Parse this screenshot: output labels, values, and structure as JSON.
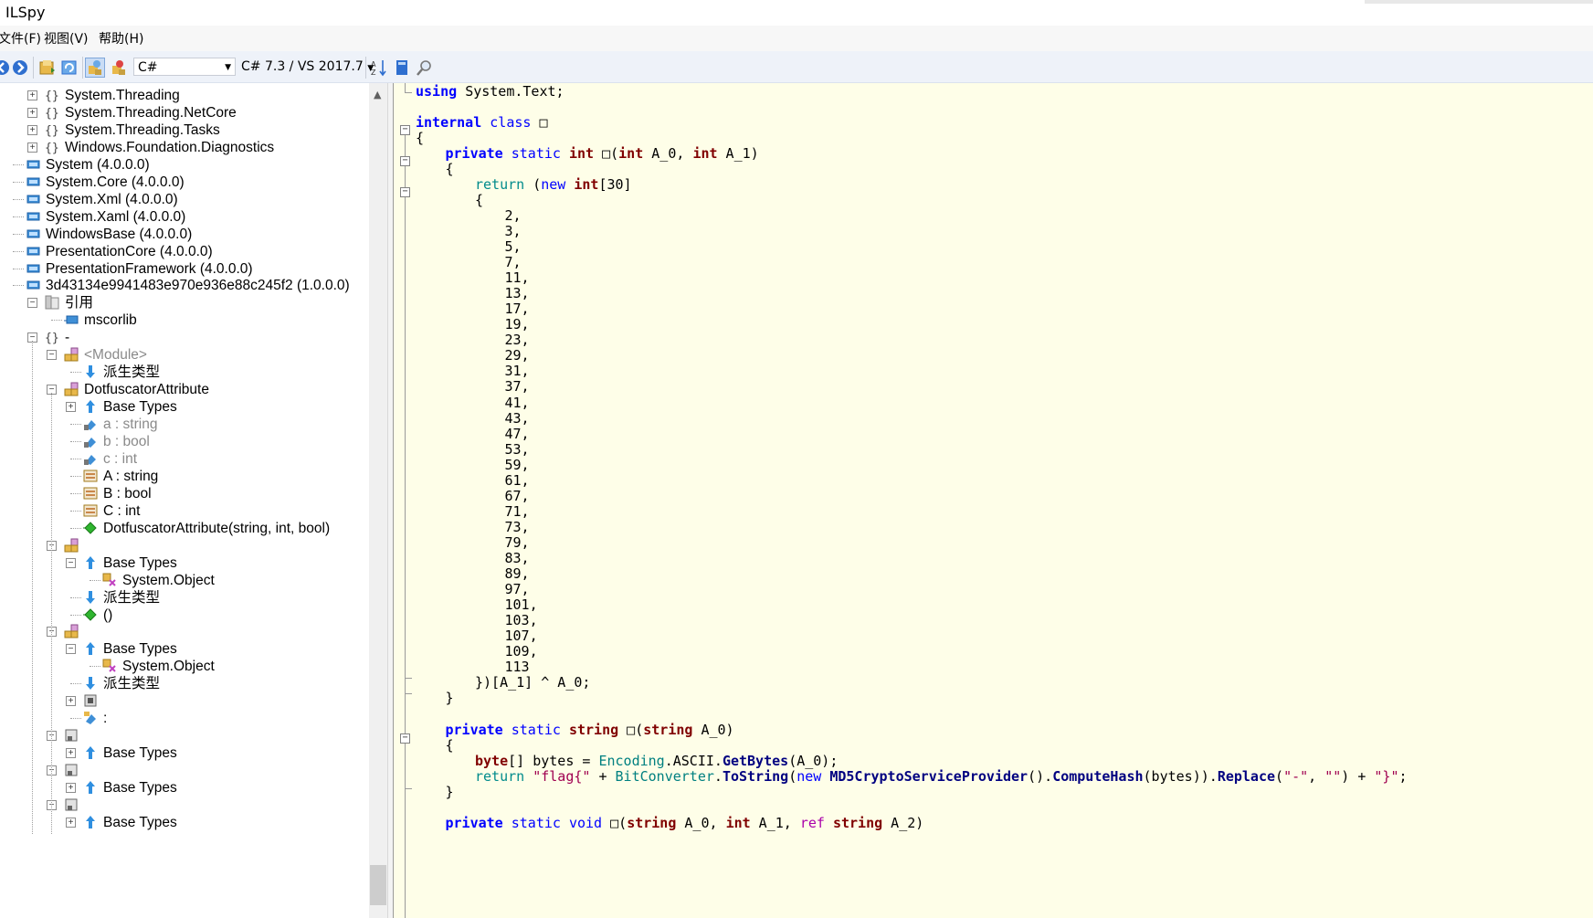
{
  "window": {
    "title": "ILSpy"
  },
  "menu": [
    "文件(F)",
    "视图(V)",
    "帮助(H)"
  ],
  "toolbar": {
    "language": "C#",
    "version": "C# 7.3 / VS 2017.7"
  },
  "tree": [
    {
      "label": "System.Threading",
      "icon": "namespace-icon",
      "toggle": "+"
    },
    {
      "label": "System.Threading.NetCore",
      "icon": "namespace-icon",
      "toggle": "+"
    },
    {
      "label": "System.Threading.Tasks",
      "icon": "namespace-icon",
      "toggle": "+"
    },
    {
      "label": "Windows.Foundation.Diagnostics",
      "icon": "namespace-icon",
      "toggle": "+"
    },
    {
      "label": "System (4.0.0.0)",
      "icon": "assembly-icon",
      "toggle": ""
    },
    {
      "label": "System.Core (4.0.0.0)",
      "icon": "assembly-icon",
      "toggle": ""
    },
    {
      "label": "System.Xml (4.0.0.0)",
      "icon": "assembly-icon",
      "toggle": ""
    },
    {
      "label": "System.Xaml (4.0.0.0)",
      "icon": "assembly-icon",
      "toggle": ""
    },
    {
      "label": "WindowsBase (4.0.0.0)",
      "icon": "assembly-icon",
      "toggle": ""
    },
    {
      "label": "PresentationCore (4.0.0.0)",
      "icon": "assembly-icon",
      "toggle": ""
    },
    {
      "label": "PresentationFramework (4.0.0.0)",
      "icon": "assembly-icon",
      "toggle": ""
    },
    {
      "label": "3d43134e9941483e970e936e88c245f2 (1.0.0.0)",
      "icon": "assembly-icon",
      "toggle": ""
    },
    {
      "label": "引用",
      "icon": "references-icon",
      "toggle": "−"
    },
    {
      "label": "mscorlib",
      "icon": "assembly-ref-icon",
      "toggle": ""
    },
    {
      "label": "-",
      "icon": "namespace-icon",
      "toggle": "−"
    },
    {
      "label": "<Module>",
      "icon": "class-icon",
      "toggle": "−",
      "dim": true
    },
    {
      "label": "派生类型",
      "icon": "derived-types-icon",
      "toggle": ""
    },
    {
      "label": "DotfuscatorAttribute",
      "icon": "class-icon",
      "toggle": "−"
    },
    {
      "label": "Base Types",
      "icon": "base-types-icon",
      "toggle": "+"
    },
    {
      "label": "a : string",
      "icon": "field-private-icon",
      "toggle": "",
      "dim": true
    },
    {
      "label": "b : bool",
      "icon": "field-private-icon",
      "toggle": "",
      "dim": true
    },
    {
      "label": "c : int",
      "icon": "field-private-icon",
      "toggle": "",
      "dim": true
    },
    {
      "label": "A : string",
      "icon": "property-icon",
      "toggle": ""
    },
    {
      "label": "B : bool",
      "icon": "property-icon",
      "toggle": ""
    },
    {
      "label": "C : int",
      "icon": "property-icon",
      "toggle": ""
    },
    {
      "label": "DotfuscatorAttribute(string, int, bool)",
      "icon": "method-icon",
      "toggle": ""
    },
    {
      "label": "",
      "icon": "class-icon",
      "toggle": "−"
    },
    {
      "label": "Base Types",
      "icon": "base-types-icon",
      "toggle": "−"
    },
    {
      "label": "System.Object",
      "icon": "class-ref-icon",
      "toggle": ""
    },
    {
      "label": "派生类型",
      "icon": "derived-types-icon",
      "toggle": ""
    },
    {
      "label": "()",
      "icon": "method-icon",
      "toggle": ""
    },
    {
      "label": "",
      "icon": "class-icon",
      "toggle": "−"
    },
    {
      "label": "Base Types",
      "icon": "base-types-icon",
      "toggle": "−"
    },
    {
      "label": "System.Object",
      "icon": "class-ref-icon",
      "toggle": ""
    },
    {
      "label": "派生类型",
      "icon": "derived-types-icon",
      "toggle": ""
    },
    {
      "label": "",
      "icon": "nested-class-icon",
      "toggle": "+"
    },
    {
      "label": ":",
      "icon": "field-icon",
      "toggle": ""
    },
    {
      "label": "",
      "icon": "struct-icon",
      "toggle": "−"
    },
    {
      "label": "Base Types",
      "icon": "base-types-icon",
      "toggle": "+"
    },
    {
      "label": "",
      "icon": "struct-icon",
      "toggle": "−"
    },
    {
      "label": "Base Types",
      "icon": "base-types-icon",
      "toggle": "+"
    },
    {
      "label": "",
      "icon": "struct-icon",
      "toggle": "−"
    },
    {
      "label": "Base Types",
      "icon": "base-types-icon",
      "toggle": "+"
    }
  ],
  "code": {
    "using": "using System.Text;",
    "primes": [
      "2,",
      "3,",
      "5,",
      "7,",
      "11,",
      "13,",
      "17,",
      "19,",
      "23,",
      "29,",
      "31,",
      "37,",
      "41,",
      "43,",
      "47,",
      "53,",
      "59,",
      "61,",
      "67,",
      "71,",
      "73,",
      "79,",
      "83,",
      "89,",
      "97,",
      "101,",
      "103,",
      "107,",
      "109,",
      "113"
    ]
  }
}
